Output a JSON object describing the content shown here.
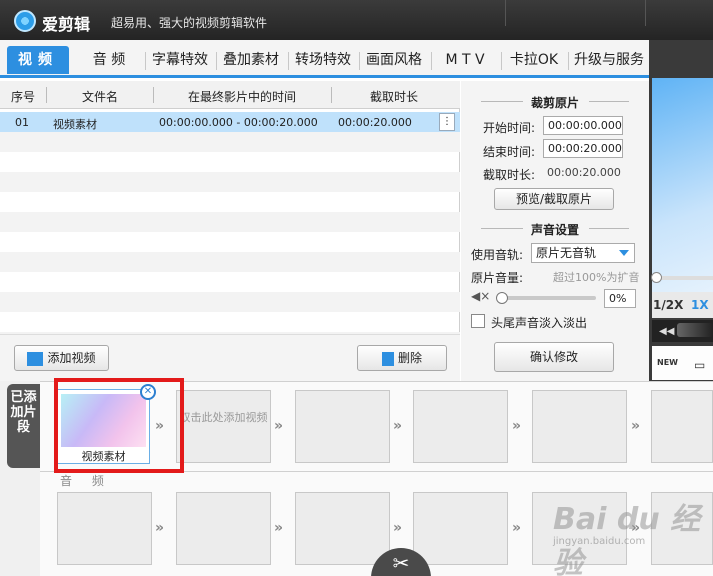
{
  "app": {
    "name": "爱剪辑",
    "slogan": "超易用、强大的视频剪辑软件"
  },
  "tabs": [
    {
      "label": "视频",
      "active": true
    },
    {
      "label": "音 频"
    },
    {
      "label": "字幕特效"
    },
    {
      "label": "叠加素材"
    },
    {
      "label": "转场特效"
    },
    {
      "label": "画面风格"
    },
    {
      "label": "M T V"
    },
    {
      "label": "卡拉OK"
    },
    {
      "label": "升级与服务"
    }
  ],
  "file_list": {
    "columns": [
      "序号",
      "文件名",
      "在最终影片中的时间",
      "截取时长"
    ],
    "rows": [
      {
        "index": "01",
        "name": "视频素材",
        "range": "00:00:00.000 - 00:00:20.000",
        "duration": "00:00:20.000",
        "menu": "⋮"
      }
    ],
    "add_button": "添加视频",
    "delete_button": "删除"
  },
  "trim": {
    "title": "裁剪原片",
    "start_label": "开始时间:",
    "start_value": "00:00:00.000",
    "end_label": "结束时间:",
    "end_value": "00:00:20.000",
    "dur_label": "截取时长:",
    "dur_value": "00:00:20.000",
    "preview_button": "预览/截取原片"
  },
  "sound": {
    "title": "声音设置",
    "track_label": "使用音轨:",
    "track_value": "原片无音轨",
    "volume_label": "原片音量:",
    "volume_hint": "超过100%为扩音",
    "volume_value": "0%",
    "volume_level": 0,
    "fade_label": "头尾声音淡入淡出",
    "fade_checked": false,
    "confirm_button": "确认修改"
  },
  "preview": {
    "speed_half": "1/2X",
    "speed_one": "1X",
    "new_icon_label": "NEW"
  },
  "timeline": {
    "tab_label": "已添加片段",
    "clip_name": "视频素材",
    "add_hint": "双击此处添加视频",
    "audio_label": "音 频"
  },
  "watermark": {
    "brand": "Bai du 经验",
    "url": "jingyan.baidu.com"
  },
  "colors": {
    "accent": "#2d8fe0",
    "highlight_box": "#e31a1a",
    "selected_row": "#bfe1fb"
  }
}
